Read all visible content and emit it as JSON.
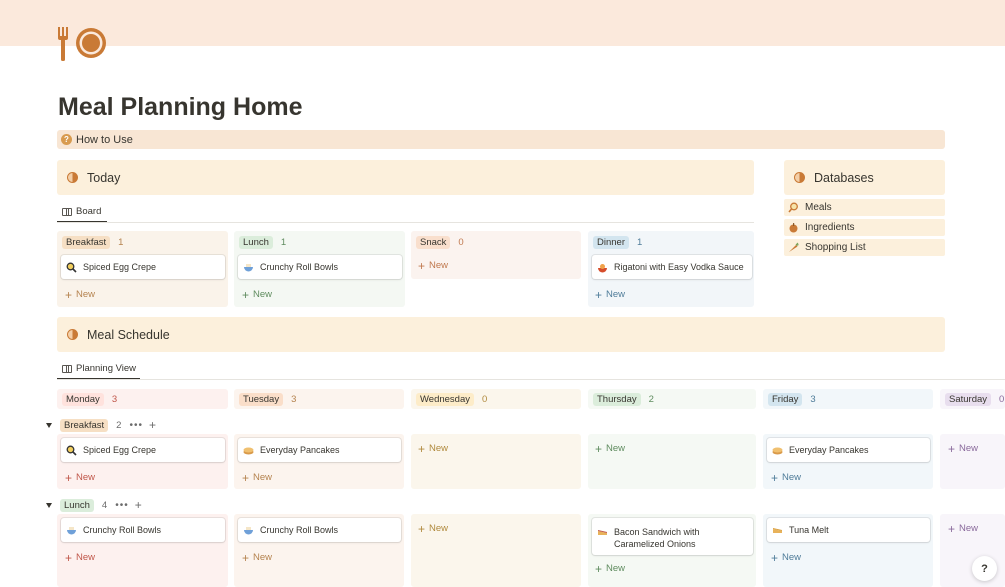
{
  "page": {
    "title": "Meal Planning Home",
    "how_to": "How to Use"
  },
  "today": {
    "heading": "Today",
    "view_label": "Board",
    "columns": [
      {
        "label": "Breakfast",
        "count": "1",
        "new": "New",
        "cards": [
          {
            "title": "Spiced Egg Crepe"
          }
        ]
      },
      {
        "label": "Lunch",
        "count": "1",
        "new": "New",
        "cards": [
          {
            "title": "Crunchy Roll Bowls"
          }
        ]
      },
      {
        "label": "Snack",
        "count": "0",
        "new": "New",
        "cards": []
      },
      {
        "label": "Dinner",
        "count": "1",
        "new": "New",
        "cards": [
          {
            "title": "Rigatoni with Easy Vodka Sauce"
          }
        ]
      }
    ]
  },
  "databases": {
    "heading": "Databases",
    "items": [
      {
        "label": "Meals"
      },
      {
        "label": "Ingredients"
      },
      {
        "label": "Shopping List"
      }
    ]
  },
  "schedule": {
    "heading": "Meal Schedule",
    "view_label": "Planning View",
    "days": [
      {
        "label": "Monday",
        "count": "3"
      },
      {
        "label": "Tuesday",
        "count": "3"
      },
      {
        "label": "Wednesday",
        "count": "0"
      },
      {
        "label": "Thursday",
        "count": "2"
      },
      {
        "label": "Friday",
        "count": "3"
      },
      {
        "label": "Saturday",
        "count": "0"
      }
    ],
    "groups": [
      {
        "label": "Breakfast",
        "count": "2",
        "dots": "•••",
        "plus": "+",
        "cells": [
          {
            "card": "Spiced Egg Crepe",
            "new": "New"
          },
          {
            "card": "Everyday Pancakes",
            "new": "New"
          },
          {
            "card": "",
            "new": "New"
          },
          {
            "card": "",
            "new": "New"
          },
          {
            "card": "Everyday Pancakes",
            "new": "New"
          },
          {
            "card": "",
            "new": "New"
          }
        ]
      },
      {
        "label": "Lunch",
        "count": "4",
        "dots": "•••",
        "plus": "+",
        "cells": [
          {
            "card": "Crunchy Roll Bowls",
            "new": "New"
          },
          {
            "card": "Crunchy Roll Bowls",
            "new": "New"
          },
          {
            "card": "",
            "new": "New"
          },
          {
            "card": "Bacon Sandwich with Caramelized Onions",
            "new": "New"
          },
          {
            "card": "Tuna Melt",
            "new": "New"
          },
          {
            "card": "",
            "new": "New"
          }
        ]
      }
    ]
  },
  "help": {
    "label": "?"
  },
  "colors": {
    "accent": "#c97a36",
    "breakfast_tag": "#f6dfc4",
    "lunch_tag": "#dbeddb",
    "snack_tag": "#f9dfcd",
    "dinner_tag": "#d3e5ef",
    "monday_tag": "#ffe2dd",
    "tuesday_tag": "#fadec9",
    "wednesday_tag": "#fdecc8",
    "thursday_tag": "#dbeddb",
    "friday_tag": "#d3e5ef",
    "saturday_tag": "#e8deee"
  }
}
